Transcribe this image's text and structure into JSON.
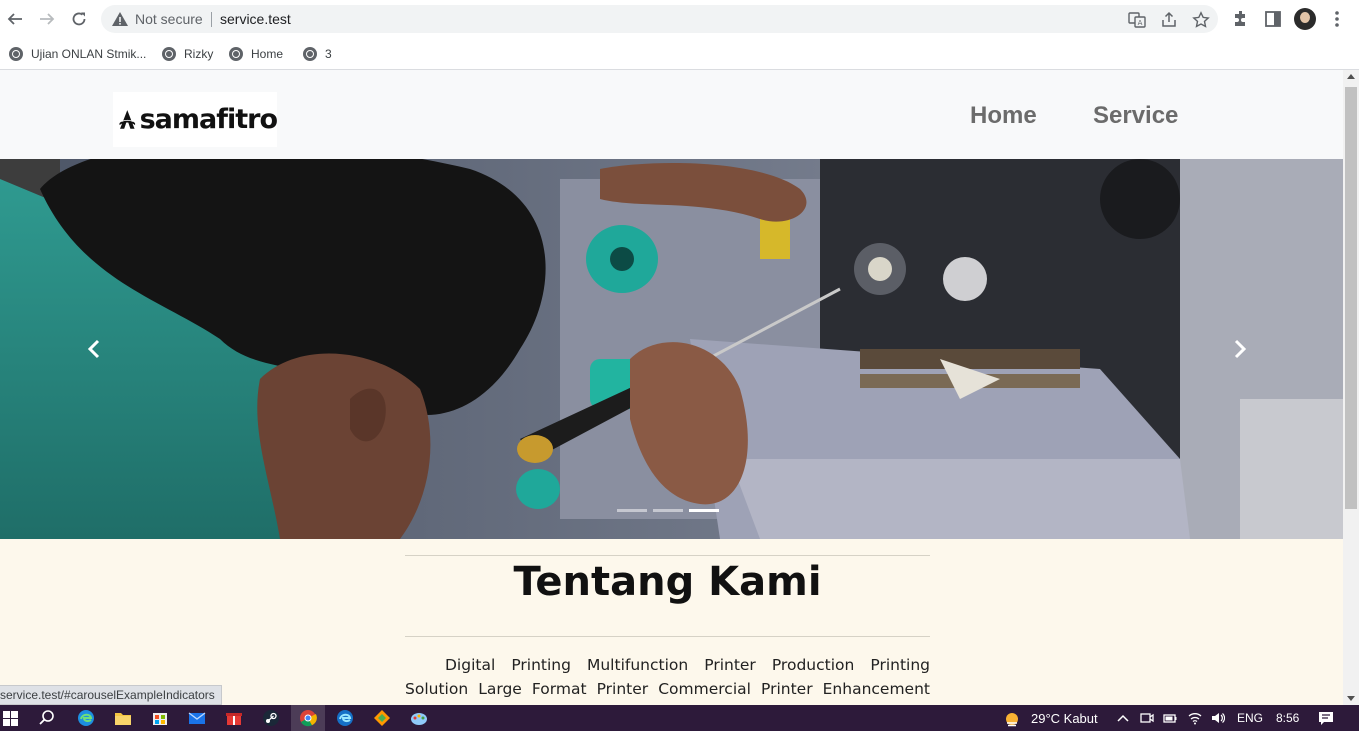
{
  "browser": {
    "security_label": "Not secure",
    "url": "service.test",
    "bookmarks": [
      {
        "label": "Ujian ONLAN Stmik..."
      },
      {
        "label": "Rizky"
      },
      {
        "label": "Home"
      },
      {
        "label": "3"
      }
    ],
    "status_url": "service.test/#carouselExampleIndicators"
  },
  "site": {
    "logo_text": "samafitro",
    "nav": [
      {
        "label": "Home"
      },
      {
        "label": "Service"
      }
    ],
    "carousel": {
      "slide_count": 3,
      "active_index": 2
    },
    "about": {
      "title": "Tentang Kami",
      "text": "Digital Printing Multifunction Printer Production Printing Solution Large Format Printer Commercial Printer Enhancement Press Textile &"
    }
  },
  "taskbar": {
    "weather": "29°C  Kabut",
    "language": "ENG",
    "time": "8:56"
  },
  "colors": {
    "page_bg": "#fdf8ec",
    "navbar_bg": "#f8f9fa",
    "nav_link": "#6b6b6b",
    "taskbar_bg": "#2d1a3a"
  }
}
